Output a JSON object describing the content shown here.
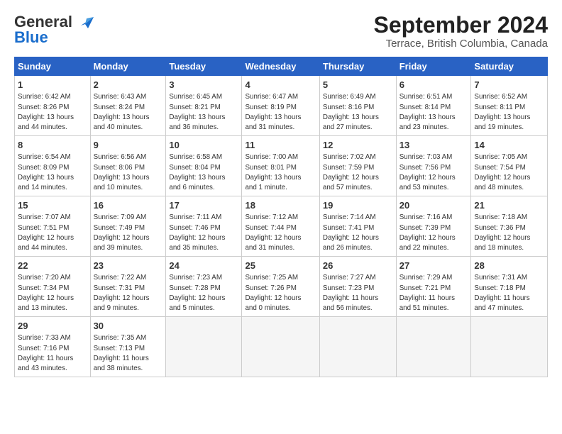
{
  "header": {
    "logo_line1": "General",
    "logo_line2": "Blue",
    "title": "September 2024",
    "subtitle": "Terrace, British Columbia, Canada"
  },
  "weekdays": [
    "Sunday",
    "Monday",
    "Tuesday",
    "Wednesday",
    "Thursday",
    "Friday",
    "Saturday"
  ],
  "weeks": [
    [
      {
        "day": "1",
        "info": "Sunrise: 6:42 AM\nSunset: 8:26 PM\nDaylight: 13 hours\nand 44 minutes."
      },
      {
        "day": "2",
        "info": "Sunrise: 6:43 AM\nSunset: 8:24 PM\nDaylight: 13 hours\nand 40 minutes."
      },
      {
        "day": "3",
        "info": "Sunrise: 6:45 AM\nSunset: 8:21 PM\nDaylight: 13 hours\nand 36 minutes."
      },
      {
        "day": "4",
        "info": "Sunrise: 6:47 AM\nSunset: 8:19 PM\nDaylight: 13 hours\nand 31 minutes."
      },
      {
        "day": "5",
        "info": "Sunrise: 6:49 AM\nSunset: 8:16 PM\nDaylight: 13 hours\nand 27 minutes."
      },
      {
        "day": "6",
        "info": "Sunrise: 6:51 AM\nSunset: 8:14 PM\nDaylight: 13 hours\nand 23 minutes."
      },
      {
        "day": "7",
        "info": "Sunrise: 6:52 AM\nSunset: 8:11 PM\nDaylight: 13 hours\nand 19 minutes."
      }
    ],
    [
      {
        "day": "8",
        "info": "Sunrise: 6:54 AM\nSunset: 8:09 PM\nDaylight: 13 hours\nand 14 minutes."
      },
      {
        "day": "9",
        "info": "Sunrise: 6:56 AM\nSunset: 8:06 PM\nDaylight: 13 hours\nand 10 minutes."
      },
      {
        "day": "10",
        "info": "Sunrise: 6:58 AM\nSunset: 8:04 PM\nDaylight: 13 hours\nand 6 minutes."
      },
      {
        "day": "11",
        "info": "Sunrise: 7:00 AM\nSunset: 8:01 PM\nDaylight: 13 hours\nand 1 minute."
      },
      {
        "day": "12",
        "info": "Sunrise: 7:02 AM\nSunset: 7:59 PM\nDaylight: 12 hours\nand 57 minutes."
      },
      {
        "day": "13",
        "info": "Sunrise: 7:03 AM\nSunset: 7:56 PM\nDaylight: 12 hours\nand 53 minutes."
      },
      {
        "day": "14",
        "info": "Sunrise: 7:05 AM\nSunset: 7:54 PM\nDaylight: 12 hours\nand 48 minutes."
      }
    ],
    [
      {
        "day": "15",
        "info": "Sunrise: 7:07 AM\nSunset: 7:51 PM\nDaylight: 12 hours\nand 44 minutes."
      },
      {
        "day": "16",
        "info": "Sunrise: 7:09 AM\nSunset: 7:49 PM\nDaylight: 12 hours\nand 39 minutes."
      },
      {
        "day": "17",
        "info": "Sunrise: 7:11 AM\nSunset: 7:46 PM\nDaylight: 12 hours\nand 35 minutes."
      },
      {
        "day": "18",
        "info": "Sunrise: 7:12 AM\nSunset: 7:44 PM\nDaylight: 12 hours\nand 31 minutes."
      },
      {
        "day": "19",
        "info": "Sunrise: 7:14 AM\nSunset: 7:41 PM\nDaylight: 12 hours\nand 26 minutes."
      },
      {
        "day": "20",
        "info": "Sunrise: 7:16 AM\nSunset: 7:39 PM\nDaylight: 12 hours\nand 22 minutes."
      },
      {
        "day": "21",
        "info": "Sunrise: 7:18 AM\nSunset: 7:36 PM\nDaylight: 12 hours\nand 18 minutes."
      }
    ],
    [
      {
        "day": "22",
        "info": "Sunrise: 7:20 AM\nSunset: 7:34 PM\nDaylight: 12 hours\nand 13 minutes."
      },
      {
        "day": "23",
        "info": "Sunrise: 7:22 AM\nSunset: 7:31 PM\nDaylight: 12 hours\nand 9 minutes."
      },
      {
        "day": "24",
        "info": "Sunrise: 7:23 AM\nSunset: 7:28 PM\nDaylight: 12 hours\nand 5 minutes."
      },
      {
        "day": "25",
        "info": "Sunrise: 7:25 AM\nSunset: 7:26 PM\nDaylight: 12 hours\nand 0 minutes."
      },
      {
        "day": "26",
        "info": "Sunrise: 7:27 AM\nSunset: 7:23 PM\nDaylight: 11 hours\nand 56 minutes."
      },
      {
        "day": "27",
        "info": "Sunrise: 7:29 AM\nSunset: 7:21 PM\nDaylight: 11 hours\nand 51 minutes."
      },
      {
        "day": "28",
        "info": "Sunrise: 7:31 AM\nSunset: 7:18 PM\nDaylight: 11 hours\nand 47 minutes."
      }
    ],
    [
      {
        "day": "29",
        "info": "Sunrise: 7:33 AM\nSunset: 7:16 PM\nDaylight: 11 hours\nand 43 minutes."
      },
      {
        "day": "30",
        "info": "Sunrise: 7:35 AM\nSunset: 7:13 PM\nDaylight: 11 hours\nand 38 minutes."
      },
      {
        "day": "",
        "info": ""
      },
      {
        "day": "",
        "info": ""
      },
      {
        "day": "",
        "info": ""
      },
      {
        "day": "",
        "info": ""
      },
      {
        "day": "",
        "info": ""
      }
    ]
  ]
}
